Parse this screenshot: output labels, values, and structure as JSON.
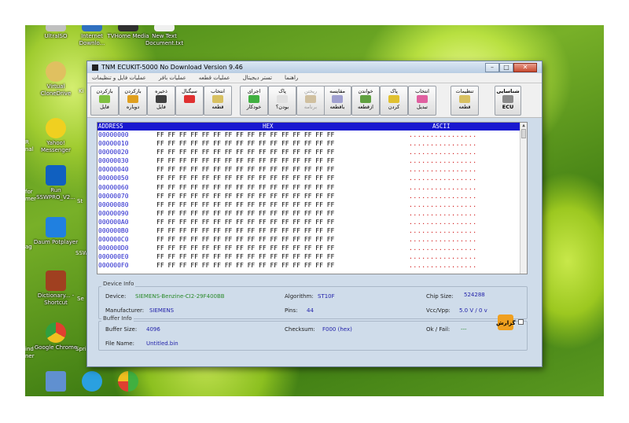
{
  "window": {
    "title": "TNM ECUKIT-5000  No Download    Version 9.46",
    "minimize_glyph": "–",
    "maximize_glyph": "□",
    "close_glyph": "✕"
  },
  "menu": [
    "راهنما",
    "تستر دیجیتال",
    "عملیات قطعه",
    "عملیات بافر",
    "عملیات فایل و تنظیمات"
  ],
  "toolbar": [
    {
      "label1": "شناسایی",
      "label2": "ECU",
      "icon": "ecu-chip-icon",
      "color": "#8a8a8a",
      "enabled": true
    },
    {
      "label1": "تنظیمات",
      "label2": "قطعه",
      "icon": "settings-chip-icon",
      "color": "#d8c060",
      "enabled": true
    },
    {
      "label1": "انتخاب",
      "label2": "تبدیل",
      "icon": "convert-icon",
      "color": "#e060a0",
      "enabled": true
    },
    {
      "label1": "پاک",
      "label2": "کردن",
      "icon": "erase-icon",
      "color": "#e0c030",
      "enabled": true
    },
    {
      "label1": "خواندن",
      "label2": "ازقطعه",
      "icon": "read-icon",
      "color": "#60a040",
      "enabled": true
    },
    {
      "label1": "مقایسه",
      "label2": "باقطعه",
      "icon": "compare-icon",
      "color": "#a0a0d0",
      "enabled": true
    },
    {
      "label1": "ریختن",
      "label2": "برنامه",
      "icon": "program-icon",
      "color": "#d0c0a0",
      "enabled": false
    },
    {
      "label1": "پاک",
      "label2": "بودن؟",
      "icon": "blank-check-icon",
      "color": "#e0e0e0",
      "enabled": true
    },
    {
      "label1": "اجرای",
      "label2": "خودکار",
      "icon": "auto-run-icon",
      "color": "#40b040",
      "enabled": true
    },
    {
      "label1": "انتخاب",
      "label2": "قطعه",
      "icon": "select-part-icon",
      "color": "#d8c060",
      "enabled": true
    },
    {
      "label1": "سیگنال",
      "label2": "",
      "icon": "signal-icon",
      "color": "#e03030",
      "enabled": true
    },
    {
      "label1": "ذخیره",
      "label2": "فایل",
      "icon": "save-file-icon",
      "color": "#404040",
      "enabled": true
    },
    {
      "label1": "بازکردن",
      "label2": "دوباره",
      "icon": "reopen-icon",
      "color": "#e0a020",
      "enabled": true
    },
    {
      "label1": "بازکردن",
      "label2": "فایل",
      "icon": "open-file-icon",
      "color": "#80c040",
      "enabled": true
    }
  ],
  "hex": {
    "header_address": "ADDRESS",
    "header_hex": "HEX",
    "header_ascii": "ASCII",
    "rows": [
      {
        "addr": "00000000",
        "bytes": "FF FF FF FF FF FF FF FF FF FF FF FF FF FF FF FF",
        "ascii": "................"
      },
      {
        "addr": "00000010",
        "bytes": "FF FF FF FF FF FF FF FF FF FF FF FF FF FF FF FF",
        "ascii": "................"
      },
      {
        "addr": "00000020",
        "bytes": "FF FF FF FF FF FF FF FF FF FF FF FF FF FF FF FF",
        "ascii": "................"
      },
      {
        "addr": "00000030",
        "bytes": "FF FF FF FF FF FF FF FF FF FF FF FF FF FF FF FF",
        "ascii": "................"
      },
      {
        "addr": "00000040",
        "bytes": "FF FF FF FF FF FF FF FF FF FF FF FF FF FF FF FF",
        "ascii": "................"
      },
      {
        "addr": "00000050",
        "bytes": "FF FF FF FF FF FF FF FF FF FF FF FF FF FF FF FF",
        "ascii": "................"
      },
      {
        "addr": "00000060",
        "bytes": "FF FF FF FF FF FF FF FF FF FF FF FF FF FF FF FF",
        "ascii": "................"
      },
      {
        "addr": "00000070",
        "bytes": "FF FF FF FF FF FF FF FF FF FF FF FF FF FF FF FF",
        "ascii": "................"
      },
      {
        "addr": "00000080",
        "bytes": "FF FF FF FF FF FF FF FF FF FF FF FF FF FF FF FF",
        "ascii": "................"
      },
      {
        "addr": "00000090",
        "bytes": "FF FF FF FF FF FF FF FF FF FF FF FF FF FF FF FF",
        "ascii": "................"
      },
      {
        "addr": "000000A0",
        "bytes": "FF FF FF FF FF FF FF FF FF FF FF FF FF FF FF FF",
        "ascii": "................"
      },
      {
        "addr": "000000B0",
        "bytes": "FF FF FF FF FF FF FF FF FF FF FF FF FF FF FF FF",
        "ascii": "................"
      },
      {
        "addr": "000000C0",
        "bytes": "FF FF FF FF FF FF FF FF FF FF FF FF FF FF FF FF",
        "ascii": "................"
      },
      {
        "addr": "000000D0",
        "bytes": "FF FF FF FF FF FF FF FF FF FF FF FF FF FF FF FF",
        "ascii": "................"
      },
      {
        "addr": "000000E0",
        "bytes": "FF FF FF FF FF FF FF FF FF FF FF FF FF FF FF FF",
        "ascii": "................"
      },
      {
        "addr": "000000F0",
        "bytes": "FF FF FF FF FF FF FF FF FF FF FF FF FF FF FF FF",
        "ascii": "................"
      }
    ]
  },
  "device_info": {
    "title": "Device Info",
    "device_label": "Device:",
    "device_value": "SIEMENS-Benzine-CI2-29F400BB",
    "algorithm_label": "Algorithm:",
    "algorithm_value": "ST10F",
    "chip_size_label": "Chip Size:",
    "chip_size_value": "524288",
    "manufacturer_label": "Manufacturer:",
    "manufacturer_value": "SIEMENS",
    "pins_label": "Pins:",
    "pins_value": "44",
    "vcc_label": "Vcc/Vpp:",
    "vcc_value": "5.0 V / 0 v"
  },
  "buffer_info": {
    "title": "Buffer Info",
    "buffer_size_label": "Buffer Size:",
    "buffer_size_value": "4096",
    "checksum_label": "Checksum:",
    "checksum_value": "F000 (hex)",
    "okfail_label": "Ok / Fail:",
    "okfail_value": "---",
    "filename_label": "File Name:",
    "filename_value": "Untitled.bin",
    "report_label": "گزارش"
  },
  "desktop": {
    "icons": [
      {
        "label": "UltraISO",
        "icon": "ultraiso-icon",
        "color": "#c0c0c0"
      },
      {
        "label": "Internet Downlo...",
        "icon": "idm-icon",
        "color": "#3070c0"
      },
      {
        "label": "TVHome Media",
        "icon": "tvhome-icon",
        "color": "#303030"
      },
      {
        "label": "New Text Document.txt",
        "icon": "text-document-icon",
        "color": "#f0f0f0"
      },
      {
        "label": "Virtual CloneDrive",
        "icon": "clonedrive-icon",
        "color": "#e0c060"
      },
      {
        "label": "Yahoo! Messenger",
        "icon": "yahoo-messenger-icon",
        "color": "#f0d020"
      },
      {
        "label": "Run SSWPRO_V2...",
        "icon": "sswpro-icon",
        "color": "#1060c0"
      },
      {
        "label": "Daum Potplayer",
        "icon": "potplayer-icon",
        "color": "#2080e0"
      },
      {
        "label": "Dictionary... - Shortcut",
        "icon": "dictionary-icon",
        "color": "#a04020"
      },
      {
        "label": "Google Chrome",
        "icon": "chrome-icon",
        "color": "#e04030"
      }
    ],
    "left_labels": [
      "Ki",
      "R nal",
      "for mer",
      "ag",
      "Se",
      "ind ner",
      "Spri",
      "St",
      "SSW"
    ],
    "taskbar": [
      {
        "icon": "network-icon",
        "color": "#6090d0"
      },
      {
        "icon": "telegram-icon",
        "color": "#2aa0e0"
      },
      {
        "icon": "app-icon",
        "color": "#40b040"
      }
    ]
  }
}
